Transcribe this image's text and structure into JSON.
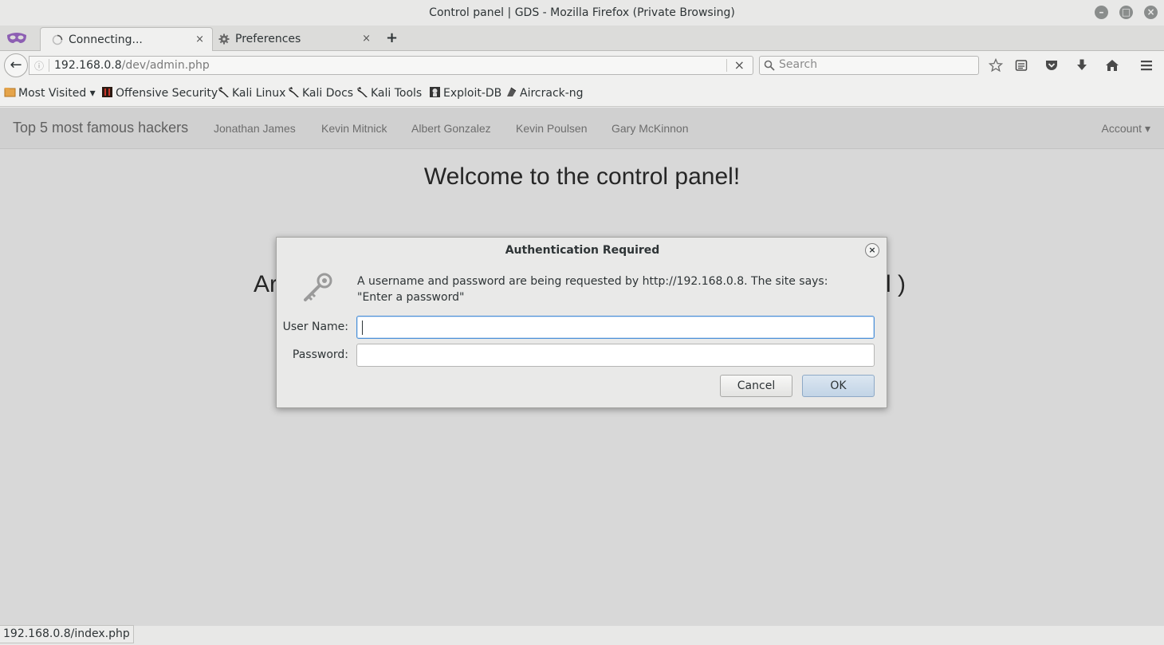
{
  "window": {
    "title": "Control panel | GDS - Mozilla Firefox (Private Browsing)",
    "controls": [
      "minimize-icon",
      "maximize-icon",
      "close-icon"
    ]
  },
  "tabs": [
    {
      "label": "Connecting...",
      "icon": "loading-spinner-icon",
      "active": true,
      "close": "×"
    },
    {
      "label": "Preferences",
      "icon": "gear-icon",
      "active": false,
      "close": "×"
    }
  ],
  "newtab_label": "+",
  "navbar": {
    "back_icon": "back-arrow-icon",
    "url_host": "192.168.0.8",
    "url_path": "/dev/admin.php",
    "url_stop": "×",
    "search_placeholder": "Search",
    "toolbar_icons": [
      "bookmark-star-icon",
      "reading-list-icon",
      "pocket-icon",
      "downloads-icon",
      "home-icon",
      "menu-icon"
    ]
  },
  "bookmarks": [
    {
      "label": "Most Visited ▾",
      "icon": "folder-icon"
    },
    {
      "label": "Offensive Security",
      "icon": "offsec-icon"
    },
    {
      "label": "Kali Linux",
      "icon": "kali-dragon-icon"
    },
    {
      "label": "Kali Docs",
      "icon": "kali-dragon-icon"
    },
    {
      "label": "Kali Tools",
      "icon": "kali-dragon-icon"
    },
    {
      "label": "Exploit-DB",
      "icon": "exploitdb-icon"
    },
    {
      "label": "Aircrack-ng",
      "icon": "aircrack-icon"
    }
  ],
  "site": {
    "brand": "Top 5 most famous hackers",
    "links": [
      "Jonathan James",
      "Kevin Mitnick",
      "Albert Gonzalez",
      "Kevin Poulsen",
      "Gary McKinnon"
    ],
    "account": "Account ▾",
    "welcome": "Welcome to the control panel!",
    "fragment_left": "Ar",
    "fragment_right": "l )"
  },
  "dialog": {
    "title": "Authentication Required",
    "close": "×",
    "message": "A username and password are being requested by http://192.168.0.8. The site says: \"Enter a password\"",
    "username_label": "User Name:",
    "username_value": "",
    "password_label": "Password:",
    "password_value": "",
    "cancel_label": "Cancel",
    "ok_label": "OK"
  },
  "statusbar": {
    "text": "192.168.0.8/index.php"
  }
}
